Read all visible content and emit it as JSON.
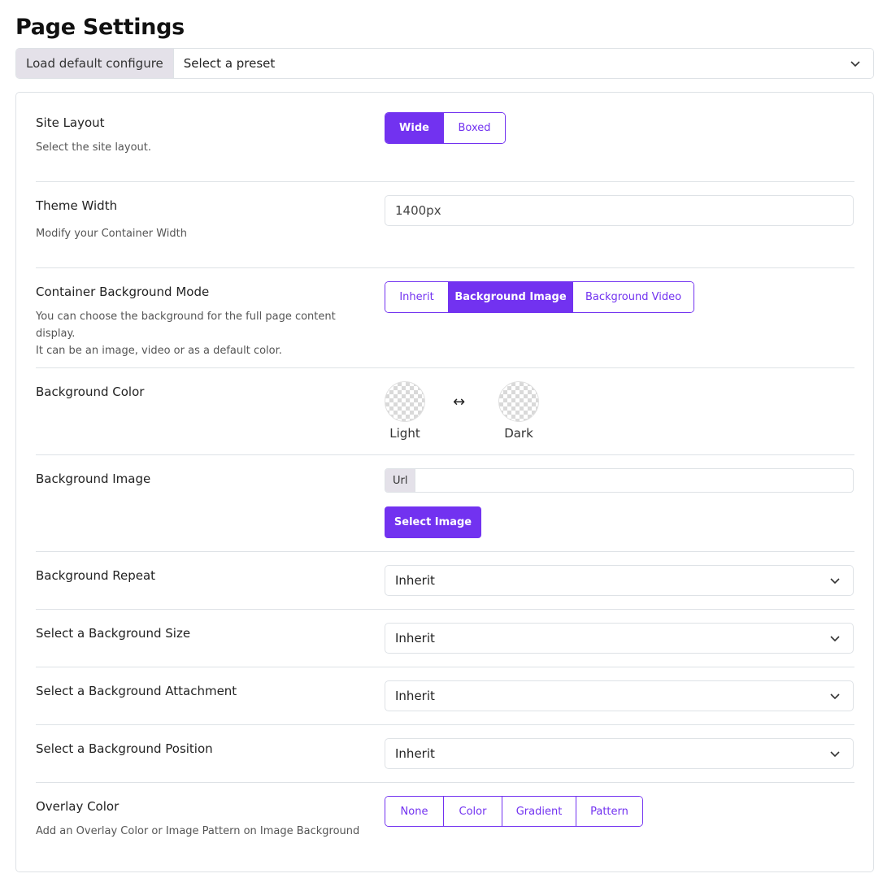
{
  "page": {
    "title": "Page Settings"
  },
  "preset": {
    "label": "Load default configure",
    "value": "Select a preset"
  },
  "colors": {
    "accent": "#7232f0",
    "addon_bg": "#e4e1e9",
    "border": "#dee2e6"
  },
  "site_layout": {
    "label": "Site Layout",
    "description": "Select the site layout.",
    "options": [
      "Wide",
      "Boxed"
    ],
    "selected": "Wide"
  },
  "theme_width": {
    "label": "Theme Width",
    "description": "Modify your Container Width",
    "value": "1400px"
  },
  "container_bg_mode": {
    "label": "Container Background Mode",
    "description_line1": "You can choose the background for the full page content display.",
    "description_line2": "It can be an image, video or as a default color.",
    "options": [
      "Inherit",
      "Background Image",
      "Background Video"
    ],
    "selected": "Background Image"
  },
  "background_color": {
    "label": "Background Color",
    "light_label": "Light",
    "dark_label": "Dark",
    "swap_icon": "↔"
  },
  "background_image": {
    "label": "Background Image",
    "url_addon": "Url",
    "url_value": "",
    "button_label": "Select Image"
  },
  "background_repeat": {
    "label": "Background Repeat",
    "value": "Inherit"
  },
  "background_size": {
    "label": "Select a Background Size",
    "value": "Inherit"
  },
  "background_attachment": {
    "label": "Select a Background Attachment",
    "value": "Inherit"
  },
  "background_position": {
    "label": "Select a Background Position",
    "value": "Inherit"
  },
  "overlay_color": {
    "label": "Overlay Color",
    "description": "Add an Overlay Color or Image Pattern on Image Background",
    "options": [
      "None",
      "Color",
      "Gradient",
      "Pattern"
    ],
    "selected": ""
  }
}
